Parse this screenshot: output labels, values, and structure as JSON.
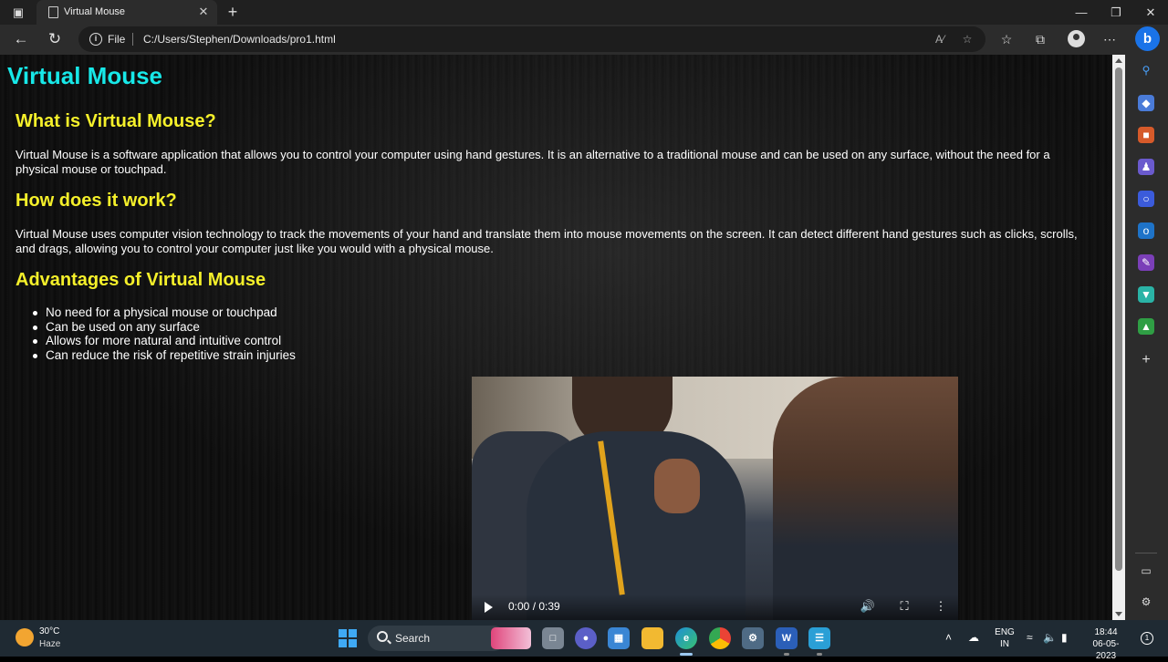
{
  "browser": {
    "tab_title": "Virtual Mouse",
    "address": {
      "scheme_label": "File",
      "url": "C:/Users/Stephen/Downloads/pro1.html"
    }
  },
  "page": {
    "title": "Virtual Mouse",
    "sections": [
      {
        "heading": "What is Virtual Mouse?",
        "text": "Virtual Mouse is a software application that allows you to control your computer using hand gestures. It is an alternative to a traditional mouse and can be used on any surface, without the need for a physical mouse or touchpad."
      },
      {
        "heading": "How does it work?",
        "text": "Virtual Mouse uses computer vision technology to track the movements of your hand and translate them into mouse movements on the screen. It can detect different hand gestures such as clicks, scrolls, and drags, allowing you to control your computer just like you would with a physical mouse."
      },
      {
        "heading": "Advantages of Virtual Mouse",
        "items": [
          "No need for a physical mouse or touchpad",
          "Can be used on any surface",
          "Allows for more natural and intuitive control",
          "Can reduce the risk of repetitive strain injuries"
        ]
      }
    ],
    "video": {
      "time": "0:00 / 0:39"
    }
  },
  "taskbar": {
    "weather": {
      "temp": "30°C",
      "condition": "Haze"
    },
    "search_label": "Search",
    "language": {
      "line1": "ENG",
      "line2": "IN"
    },
    "clock": {
      "time": "18:44",
      "date": "06-05-2023"
    }
  },
  "colors": {
    "title": "#17e8e8",
    "heading": "#f5f02a",
    "body_text": "#ffffff",
    "browser_chrome": "#2c2c2c",
    "taskbar": "#1f2a33"
  }
}
